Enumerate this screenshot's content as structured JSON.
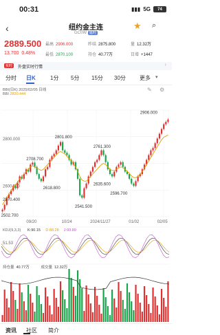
{
  "status_bar": {
    "time": "00:31",
    "network": "5G",
    "battery": "74"
  },
  "header": {
    "back_icon": "chevron-left-icon",
    "title": "纽约金主连",
    "code": "GC0W",
    "tag": "延时"
  },
  "quote": {
    "price": "2889.500",
    "change": "13.700",
    "change_pct": "0.48%",
    "high_label": "最高",
    "high": "2906.000",
    "low_label": "最低",
    "low": "2870.100",
    "prev_settle_label": "昨结",
    "prev_settle": "2875.800",
    "holding_label": "持仓",
    "holding": "40.77万",
    "volume_label": "量",
    "volume": "12.32万",
    "day_change_label": "日增",
    "day_change": "+1447"
  },
  "banner": {
    "badge": "实时",
    "text": "外盘实时行情"
  },
  "periods": {
    "items": [
      "分时",
      "日K",
      "1分",
      "5分",
      "15分",
      "30分",
      "更多"
    ],
    "active": "日K"
  },
  "chart_legend": {
    "name": "BBI(日K)",
    "date": "2025/02/05",
    "line": "日线",
    "bbi_label": "BBI",
    "bbi_value": "2820.444"
  },
  "chart_data": [
    {
      "type": "candlestick",
      "x_labels": [
        "09/20",
        "10/24",
        "2024/11/27",
        "01/02",
        "02/05"
      ],
      "y_ticks": [
        "2800.000",
        "2600.000"
      ],
      "annotations": [
        "2906.000",
        "2801.800",
        "2761.300",
        "2708.700",
        "2635.600",
        "2618.800",
        "2596.700",
        "2570.400",
        "2541.500",
        "2502.700"
      ],
      "ylim": [
        2480,
        2930
      ],
      "close_values": [
        2510,
        2530,
        2560,
        2575,
        2590,
        2610,
        2600,
        2625,
        2650,
        2640,
        2660,
        2680,
        2670,
        2700,
        2708,
        2690,
        2660,
        2640,
        2630,
        2650,
        2680,
        2690,
        2720,
        2735,
        2745,
        2760,
        2780,
        2795,
        2760,
        2750,
        2740,
        2720,
        2700,
        2710,
        2680,
        2640,
        2570,
        2560,
        2600,
        2620,
        2650,
        2670,
        2690,
        2710,
        2720,
        2740,
        2760,
        2740,
        2710,
        2680,
        2660,
        2650,
        2670,
        2690,
        2700,
        2710,
        2690,
        2670,
        2660,
        2640,
        2620,
        2610,
        2630,
        2650,
        2660,
        2680,
        2700,
        2720,
        2740,
        2760,
        2770,
        2790,
        2810,
        2830,
        2850,
        2870,
        2880,
        2890
      ],
      "bbi_values": [
        2530,
        2545,
        2560,
        2575,
        2590,
        2605,
        2615,
        2625,
        2640,
        2650,
        2660,
        2670,
        2680,
        2690,
        2695,
        2690,
        2685,
        2680,
        2675,
        2680,
        2690,
        2700,
        2710,
        2720,
        2730,
        2740,
        2750,
        2755,
        2750,
        2745,
        2735,
        2725,
        2715,
        2705,
        2690,
        2670,
        2650,
        2635,
        2630,
        2630,
        2640,
        2650,
        2660,
        2670,
        2680,
        2690,
        2700,
        2705,
        2700,
        2690,
        2680,
        2675,
        2675,
        2680,
        2685,
        2690,
        2688,
        2680,
        2672,
        2662,
        2652,
        2645,
        2645,
        2650,
        2660,
        2670,
        2685,
        2700,
        2715,
        2730,
        2745,
        2760,
        2775,
        2790,
        2805,
        2815,
        2820,
        2825
      ]
    },
    {
      "type": "line",
      "name": "KDJ",
      "legend": [
        "KDJ(9,3,3)",
        "K:90.15",
        "D:88.28",
        "J:93.89"
      ],
      "y_ticks": [
        "51.53"
      ]
    },
    {
      "type": "bar",
      "name": "持仓量",
      "legend": [
        "持仓量",
        "40.77万",
        "成交量",
        "12.32万"
      ]
    }
  ],
  "bottom_tabs": [
    "资讯",
    "社区",
    "简介"
  ]
}
